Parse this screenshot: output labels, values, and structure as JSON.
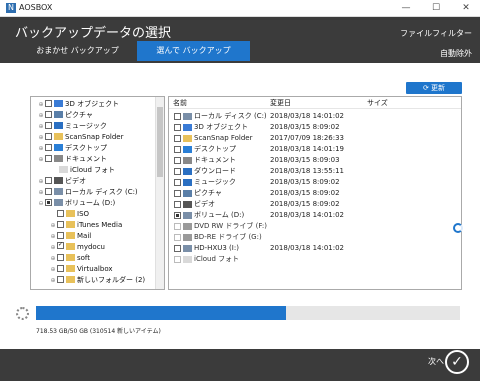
{
  "app": {
    "title": "AOSBOX",
    "logo_glyph": "N"
  },
  "window_controls": {
    "minimize": "—",
    "maximize": "☐",
    "close": "✕"
  },
  "header": {
    "title": "バックアップデータの選択",
    "right_links": [
      "ファイルフィルター",
      "自動除外"
    ],
    "tabs": [
      {
        "label": "おまかせ バックアップ",
        "active": false
      },
      {
        "label": "選んで バックアップ",
        "active": true
      }
    ],
    "colors": {
      "bar": "#3b3b3b",
      "active_tab": "#1f76cc"
    }
  },
  "refresh": {
    "label": "更新",
    "icon": "refresh-icon"
  },
  "tree": {
    "items": [
      {
        "label": "3D オブジェクト",
        "state": "empty",
        "expander": "⊕",
        "icon": "3d-objects-icon",
        "color": "#3a7bd5"
      },
      {
        "label": "ピクチャ",
        "state": "empty",
        "expander": "⊕",
        "icon": "pictures-icon",
        "color": "#5a7fa8"
      },
      {
        "label": "ミュージック",
        "state": "empty",
        "expander": "⊕",
        "icon": "music-icon",
        "color": "#2a6fc2"
      },
      {
        "label": "ScanSnap Folder",
        "state": "empty",
        "expander": "⊕",
        "icon": "folder-icon",
        "color": "#e8c15a"
      },
      {
        "label": "デスクトップ",
        "state": "empty",
        "expander": "⊕",
        "icon": "desktop-icon",
        "color": "#2a7fd6"
      },
      {
        "label": "ドキュメント",
        "state": "empty",
        "expander": "⊕",
        "icon": "documents-icon",
        "color": "#888888"
      },
      {
        "label": "iCloud フォト",
        "state": "none",
        "expander": "",
        "icon": "icloud-icon",
        "color": "#d9d9d9"
      },
      {
        "label": "ビデオ",
        "state": "empty",
        "expander": "⊕",
        "icon": "video-icon",
        "color": "#555555"
      },
      {
        "label": "ローカル ディスク (C:)",
        "state": "empty",
        "expander": "⊕",
        "icon": "drive-icon",
        "color": "#7a8fa8"
      },
      {
        "label": "ボリューム (D:)",
        "state": "partial",
        "expander": "⊖",
        "icon": "drive-icon",
        "color": "#7a8fa8"
      },
      {
        "label": "ISO",
        "state": "empty",
        "expander": "",
        "icon": "folder-icon",
        "color": "#e8c15a"
      },
      {
        "label": "iTunes Media",
        "state": "empty",
        "expander": "⊕",
        "icon": "folder-icon",
        "color": "#e8c15a"
      },
      {
        "label": "Mail",
        "state": "empty",
        "expander": "⊕",
        "icon": "folder-icon",
        "color": "#e8c15a"
      },
      {
        "label": "mydocu",
        "state": "checked",
        "expander": "⊕",
        "icon": "folder-icon",
        "color": "#e8c15a"
      },
      {
        "label": "soft",
        "state": "empty",
        "expander": "⊕",
        "icon": "folder-icon",
        "color": "#e8c15a"
      },
      {
        "label": "Virtualbox",
        "state": "empty",
        "expander": "⊕",
        "icon": "folder-icon",
        "color": "#e8c15a"
      },
      {
        "label": "新しいフォルダー (2)",
        "state": "empty",
        "expander": "⊕",
        "icon": "folder-icon",
        "color": "#e8c15a"
      }
    ]
  },
  "list": {
    "columns": [
      "名前",
      "変更日",
      "サイズ"
    ],
    "rows": [
      {
        "name": "ローカル ディスク (C:)",
        "date": "2018/03/18 14:01:02",
        "state": "empty",
        "icon": "drive-icon",
        "color": "#7a8fa8"
      },
      {
        "name": "3D オブジェクト",
        "date": "2018/03/15 8:09:02",
        "state": "empty",
        "icon": "3d-objects-icon",
        "color": "#3a7bd5"
      },
      {
        "name": "ScanSnap Folder",
        "date": "2017/07/09 18:26:33",
        "state": "empty",
        "icon": "folder-icon",
        "color": "#e8c15a"
      },
      {
        "name": "デスクトップ",
        "date": "2018/03/18 14:01:19",
        "state": "empty",
        "icon": "desktop-icon",
        "color": "#2a7fd6"
      },
      {
        "name": "ドキュメント",
        "date": "2018/03/15 8:09:03",
        "state": "empty",
        "icon": "documents-icon",
        "color": "#888888"
      },
      {
        "name": "ダウンロード",
        "date": "2018/03/18 13:55:11",
        "state": "empty",
        "icon": "download-icon",
        "color": "#2a6fc2"
      },
      {
        "name": "ミュージック",
        "date": "2018/03/15 8:09:02",
        "state": "empty",
        "icon": "music-icon",
        "color": "#2a6fc2"
      },
      {
        "name": "ピクチャ",
        "date": "2018/03/15 8:09:02",
        "state": "empty",
        "icon": "pictures-icon",
        "color": "#5a7fa8"
      },
      {
        "name": "ビデオ",
        "date": "2018/03/15 8:09:02",
        "state": "empty",
        "icon": "video-icon",
        "color": "#555555"
      },
      {
        "name": "ボリューム (D:)",
        "date": "2018/03/18 14:01:02",
        "state": "partial",
        "icon": "drive-icon",
        "color": "#7a8fa8"
      },
      {
        "name": "DVD RW ドライブ (F:)",
        "date": "",
        "state": "disabled",
        "icon": "dvd-drive-icon",
        "color": "#9a9a9a"
      },
      {
        "name": "BD-RE ドライブ (G:)",
        "date": "",
        "state": "disabled",
        "icon": "bd-drive-icon",
        "color": "#9a9a9a"
      },
      {
        "name": "HD-HXU3 (I:)",
        "date": "2018/03/18 14:01:02",
        "state": "empty",
        "icon": "drive-icon",
        "color": "#7a8fa8"
      },
      {
        "name": "iCloud フォト",
        "date": "",
        "state": "disabled",
        "icon": "icloud-icon",
        "color": "#d9d9d9"
      }
    ]
  },
  "progress": {
    "fraction": 0.59,
    "color": "#1f76cc"
  },
  "storage_text": "718.53 GB/50 GB (310514 新しいアイテム)",
  "footer": {
    "next_label": "次へ",
    "next_glyph": "✓"
  }
}
